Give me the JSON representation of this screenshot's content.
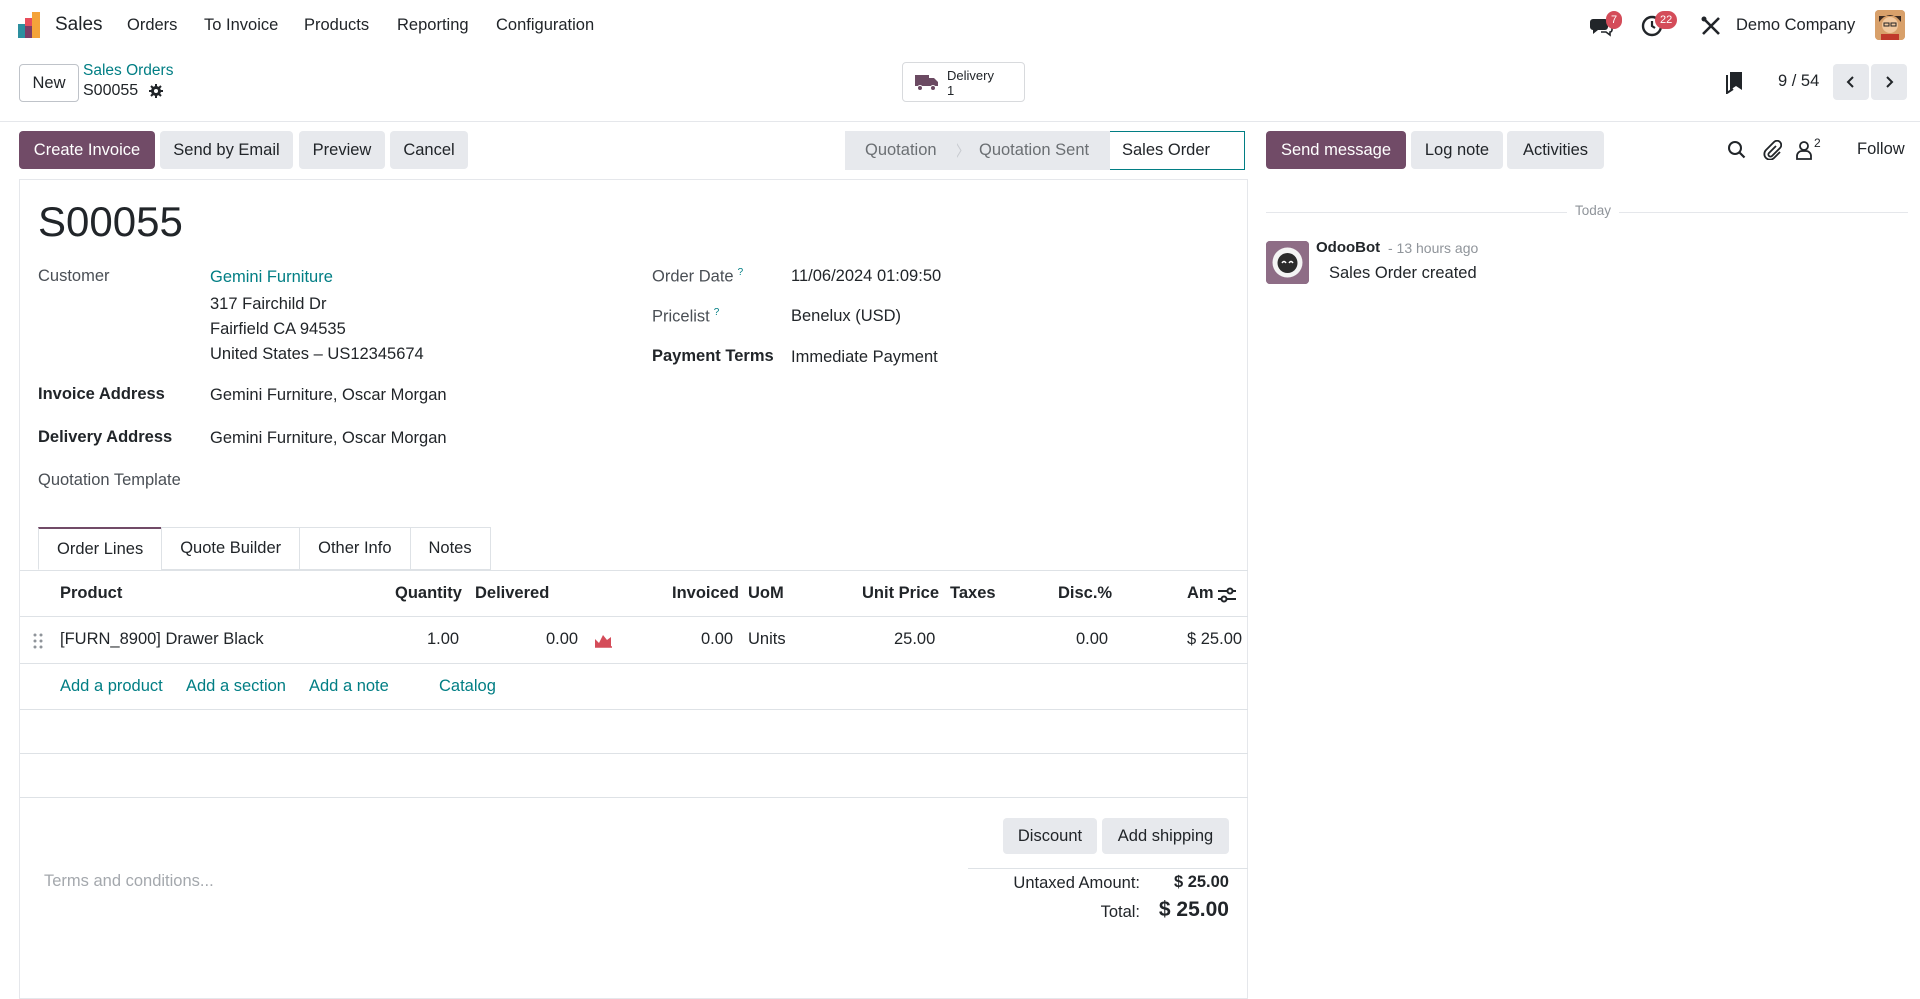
{
  "app": {
    "name": "Sales"
  },
  "menu": [
    "Orders",
    "To Invoice",
    "Products",
    "Reporting",
    "Configuration"
  ],
  "systray": {
    "messages_count": "7",
    "activities_count": "22",
    "company": "Demo Company"
  },
  "control": {
    "new_label": "New",
    "breadcrumb_parent": "Sales Orders",
    "breadcrumb_current": "S00055",
    "smart_button": {
      "label": "Delivery",
      "value": "1"
    },
    "pager": "9 / 54"
  },
  "actions": {
    "create_invoice": "Create Invoice",
    "send_email": "Send by Email",
    "preview": "Preview",
    "cancel": "Cancel"
  },
  "statusbar": {
    "stages": [
      "Quotation",
      "Quotation Sent",
      "Sales Order"
    ],
    "active": "Sales Order"
  },
  "form": {
    "title": "S00055",
    "customer_label": "Customer",
    "customer_name": "Gemini Furniture",
    "customer_address_1": "317 Fairchild Dr",
    "customer_address_2": "Fairfield CA 94535",
    "customer_address_3": "United States – US12345674",
    "invoice_address_label": "Invoice Address",
    "invoice_address": "Gemini Furniture, Oscar Morgan",
    "delivery_address_label": "Delivery Address",
    "delivery_address": "Gemini Furniture, Oscar Morgan",
    "quotation_template_label": "Quotation Template",
    "order_date_label": "Order Date",
    "order_date": "11/06/2024 01:09:50",
    "pricelist_label": "Pricelist",
    "pricelist": "Benelux (USD)",
    "payment_terms_label": "Payment Terms",
    "payment_terms": "Immediate Payment",
    "help_mark": "?"
  },
  "tabs": [
    "Order Lines",
    "Quote Builder",
    "Other Info",
    "Notes"
  ],
  "order_lines": {
    "headers": {
      "product": "Product",
      "quantity": "Quantity",
      "delivered": "Delivered",
      "invoiced": "Invoiced",
      "uom": "UoM",
      "unit_price": "Unit Price",
      "taxes": "Taxes",
      "discount": "Disc.%",
      "amount": "Am"
    },
    "rows": [
      {
        "product": "[FURN_8900] Drawer Black",
        "quantity": "1.00",
        "delivered": "0.00",
        "invoiced": "0.00",
        "uom": "Units",
        "unit_price": "25.00",
        "taxes": "",
        "discount": "0.00",
        "amount": "$ 25.00"
      }
    ],
    "add_product": "Add a product",
    "add_section": "Add a section",
    "add_note": "Add a note",
    "catalog": "Catalog"
  },
  "footer": {
    "discount_btn": "Discount",
    "shipping_btn": "Add shipping",
    "terms_placeholder": "Terms and conditions...",
    "untaxed_label": "Untaxed Amount:",
    "untaxed_value": "$ 25.00",
    "total_label": "Total:",
    "total_value": "$ 25.00"
  },
  "chatter": {
    "send_message": "Send message",
    "log_note": "Log note",
    "activities": "Activities",
    "followers_count": "2",
    "follow": "Follow",
    "date_separator": "Today",
    "messages": [
      {
        "author": "OdooBot",
        "time": "- 13 hours ago",
        "body": "Sales Order created"
      }
    ]
  },
  "colors": {
    "primary": "#714b67",
    "link": "#017e84",
    "badge": "#d44c59"
  }
}
